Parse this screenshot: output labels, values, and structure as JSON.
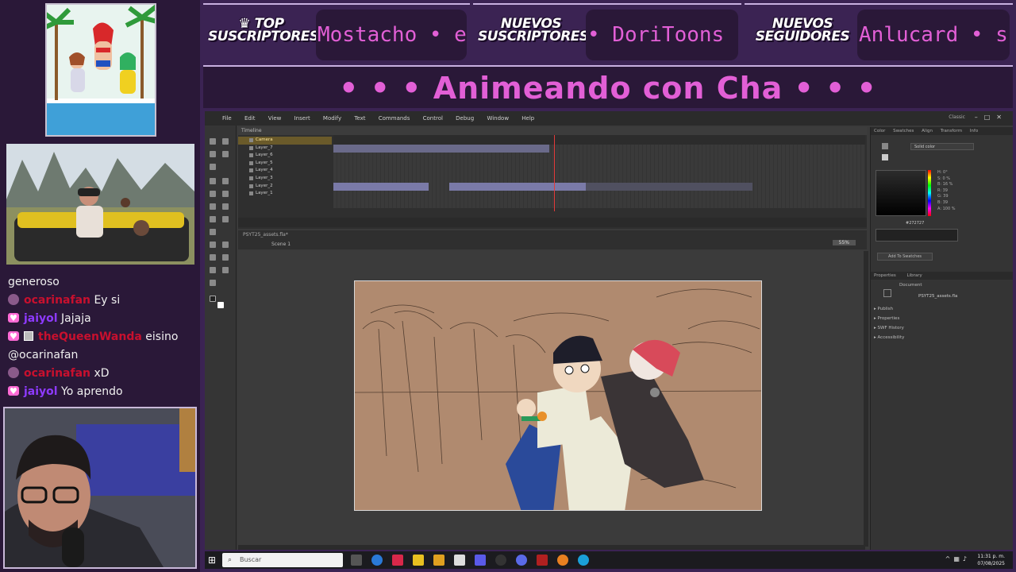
{
  "banners": [
    {
      "label": "TOP SUSCRIPTORES",
      "ticker": "Mostacho • e"
    },
    {
      "label": "NUEVOS SUSCRIPTORES",
      "ticker": "• DoriToons"
    },
    {
      "label": "NUEVOS SEGUIDORES",
      "ticker": "Anlucard • s"
    }
  ],
  "stream_title": "• • • Animeando con Cha • • •",
  "chat": {
    "lines": [
      {
        "user": "",
        "message": "generoso"
      },
      {
        "user": "ocarinafan",
        "message": "Ey si"
      },
      {
        "user": "jaiyol",
        "message": "Jajaja"
      },
      {
        "user": "theQueenWanda",
        "message": "eisino"
      },
      {
        "user": "",
        "message": "@ocarinafan"
      },
      {
        "user": "ocarinafan",
        "message": "xD"
      },
      {
        "user": "jaiyol",
        "message": "Yo aprendo"
      }
    ]
  },
  "app": {
    "menu": [
      "File",
      "Edit",
      "View",
      "Insert",
      "Modify",
      "Text",
      "Commands",
      "Control",
      "Debug",
      "Window",
      "Help"
    ],
    "workspace": "Classic",
    "timeline_tab": "Timeline",
    "layers": [
      "Camera",
      "Layer_7",
      "Layer_6",
      "Layer_5",
      "Layer_4",
      "Layer_3",
      "Layer_2",
      "Layer_1"
    ],
    "file_tab": "PSYT25_assets.fla*",
    "scene": "Scene 1",
    "zoom": "55%",
    "color_tabs": [
      "Color",
      "Swatches",
      "Align",
      "Transform",
      "Info"
    ],
    "color_type": "Solid color",
    "color_values": [
      "H: 0°",
      "S: 0 %",
      "B: 16 %",
      "R: 39",
      "G: 39",
      "B: 39",
      "A: 100 %"
    ],
    "hex": "#272727",
    "add_swatch": "Add To Swatches",
    "props_tabs": [
      "Properties",
      "Library"
    ],
    "doc_label": "Document",
    "doc_file": "PSYT25_assets.fla",
    "prop_sections": [
      "Publish",
      "Properties",
      "SWF History",
      "Accessibility"
    ]
  },
  "taskbar": {
    "search_placeholder": "Buscar",
    "time": "11:31 p. m.",
    "date": "07/08/2025"
  },
  "colors": {
    "accent": "#e25fd6",
    "panel_bg": "#2a1838",
    "frame_bg": "#3b2353",
    "canvas": "#b08a6f"
  }
}
